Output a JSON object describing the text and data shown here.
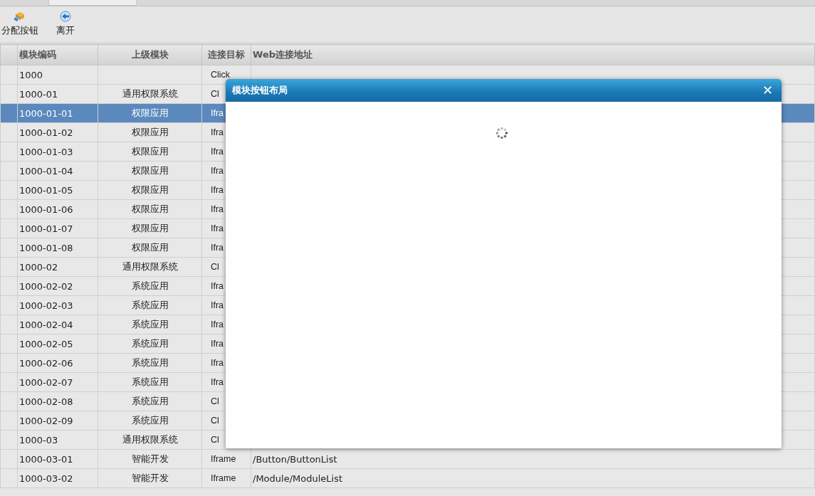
{
  "toolbar": {
    "buttons": [
      {
        "kind": "assign",
        "label": "分配按钮"
      },
      {
        "kind": "exit",
        "label": "离开"
      }
    ]
  },
  "table": {
    "columns": [
      "模块编码",
      "上级模块",
      "连接目标",
      "Web连接地址"
    ],
    "rows": [
      {
        "cells": [
          "1000",
          "",
          "Click",
          ""
        ],
        "selected": false
      },
      {
        "cells": [
          "1000-01",
          "通用权限系统",
          "Cl",
          ""
        ],
        "selected": false
      },
      {
        "cells": [
          "1000-01-01",
          "权限应用",
          "Ifra",
          ""
        ],
        "selected": true
      },
      {
        "cells": [
          "1000-01-02",
          "权限应用",
          "Ifra",
          ""
        ],
        "selected": false
      },
      {
        "cells": [
          "1000-01-03",
          "权限应用",
          "Ifra",
          ""
        ],
        "selected": false
      },
      {
        "cells": [
          "1000-01-04",
          "权限应用",
          "Ifra",
          ""
        ],
        "selected": false
      },
      {
        "cells": [
          "1000-01-05",
          "权限应用",
          "Ifra",
          ""
        ],
        "selected": false
      },
      {
        "cells": [
          "1000-01-06",
          "权限应用",
          "Ifra",
          ""
        ],
        "selected": false
      },
      {
        "cells": [
          "1000-01-07",
          "权限应用",
          "Ifra",
          ""
        ],
        "selected": false
      },
      {
        "cells": [
          "1000-01-08",
          "权限应用",
          "Ifra",
          ""
        ],
        "selected": false
      },
      {
        "cells": [
          "1000-02",
          "通用权限系统",
          "Cl",
          ""
        ],
        "selected": false
      },
      {
        "cells": [
          "1000-02-02",
          "系统应用",
          "Ifra",
          ""
        ],
        "selected": false
      },
      {
        "cells": [
          "1000-02-03",
          "系统应用",
          "Ifra",
          ""
        ],
        "selected": false
      },
      {
        "cells": [
          "1000-02-04",
          "系统应用",
          "Ifra",
          ""
        ],
        "selected": false
      },
      {
        "cells": [
          "1000-02-05",
          "系统应用",
          "Ifra",
          ""
        ],
        "selected": false
      },
      {
        "cells": [
          "1000-02-06",
          "系统应用",
          "Ifra",
          ""
        ],
        "selected": false
      },
      {
        "cells": [
          "1000-02-07",
          "系统应用",
          "Ifra",
          ""
        ],
        "selected": false
      },
      {
        "cells": [
          "1000-02-08",
          "系统应用",
          "Cl",
          ""
        ],
        "selected": false
      },
      {
        "cells": [
          "1000-02-09",
          "系统应用",
          "Cl",
          ""
        ],
        "selected": false
      },
      {
        "cells": [
          "1000-03",
          "通用权限系统",
          "Cl",
          ""
        ],
        "selected": false
      },
      {
        "cells": [
          "1000-03-01",
          "智能开发",
          "Iframe",
          "/Button/ButtonList"
        ],
        "selected": false
      },
      {
        "cells": [
          "1000-03-02",
          "智能开发",
          "Iframe",
          "/Module/ModuleList"
        ],
        "selected": false
      }
    ]
  },
  "dialog": {
    "title": "模块按钮布局",
    "close": "✕"
  }
}
